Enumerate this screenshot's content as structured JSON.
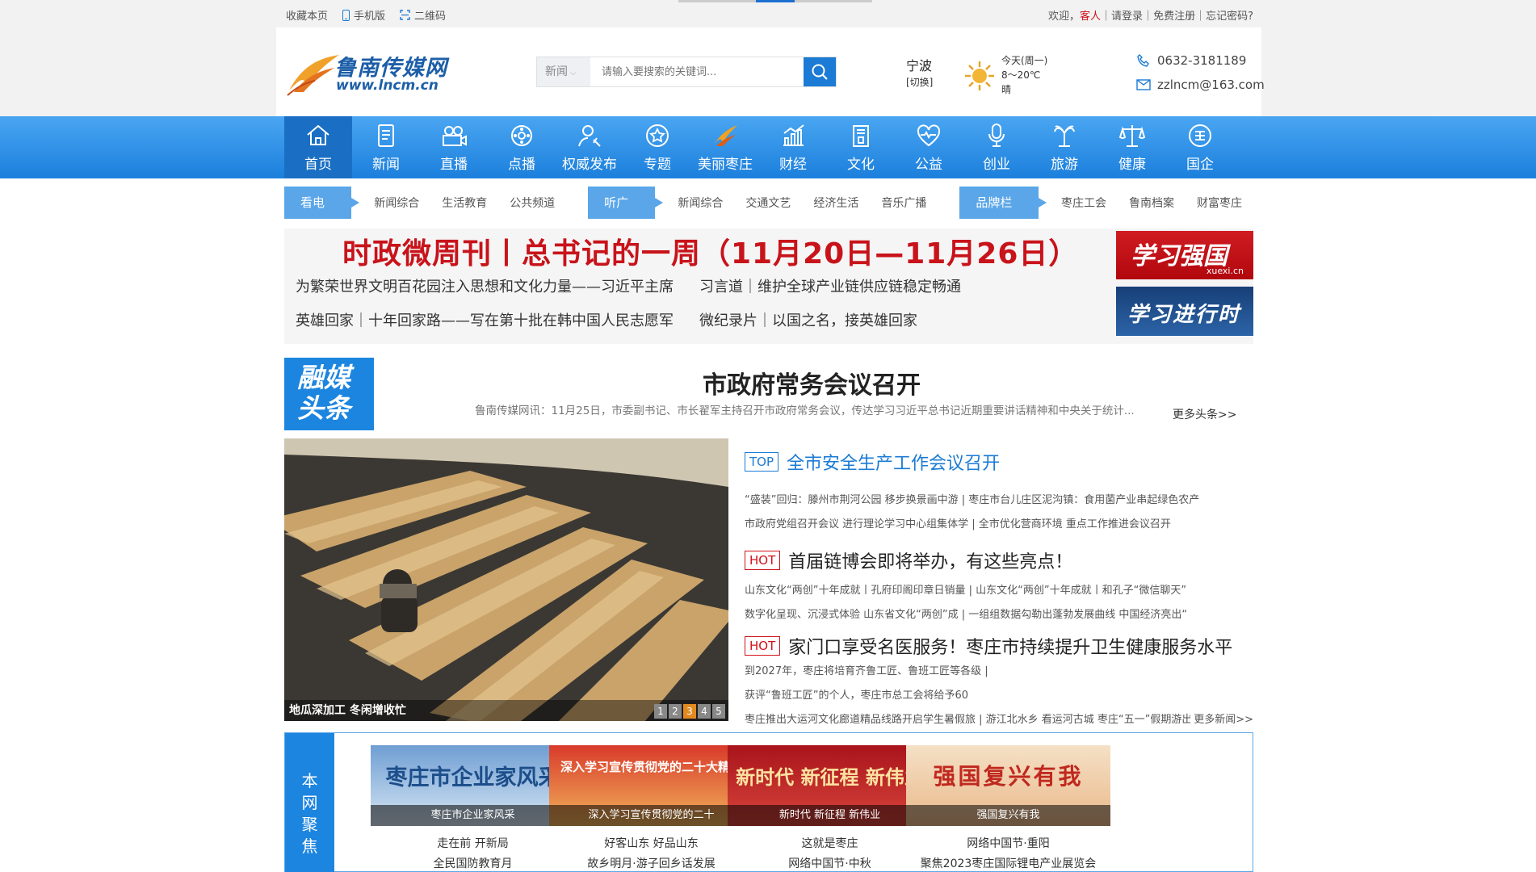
{
  "topbar": {
    "bookmark": "收藏本页",
    "mobile": "手机版",
    "qrcode": "二维码",
    "welcome": "欢迎，",
    "guest": "客人",
    "sep1": "｜",
    "login": "请登录",
    "sep2": "｜",
    "register": "免费注册",
    "sep3": "｜",
    "forgot": "忘记密码?"
  },
  "header": {
    "logo_cn": "鲁南传媒网",
    "logo_url": "www.lncm.cn",
    "search_category": "新闻",
    "search_placeholder": "请输入要搜索的关键词...",
    "city": "宁波",
    "city_switch": "[切换]",
    "weather_day": "今天(周一)",
    "weather_temp": "8～20℃",
    "weather_desc": "晴",
    "phone": "0632-3181189",
    "email": "zzlncm@163.com"
  },
  "nav": {
    "items": [
      {
        "label": "首页",
        "icon": "home-icon"
      },
      {
        "label": "新闻",
        "icon": "news-icon"
      },
      {
        "label": "直播",
        "icon": "live-icon"
      },
      {
        "label": "点播",
        "icon": "vod-icon"
      },
      {
        "label": "权威发布",
        "icon": "release-icon"
      },
      {
        "label": "专题",
        "icon": "topic-icon"
      },
      {
        "label": "美丽枣庄",
        "icon": "scenery-icon"
      },
      {
        "label": "财经",
        "icon": "finance-icon"
      },
      {
        "label": "文化",
        "icon": "culture-icon"
      },
      {
        "label": "公益",
        "icon": "charity-icon"
      },
      {
        "label": "创业",
        "icon": "startup-icon"
      },
      {
        "label": "旅游",
        "icon": "travel-icon"
      },
      {
        "label": "健康",
        "icon": "health-icon"
      },
      {
        "label": "国企",
        "icon": "soe-icon"
      }
    ]
  },
  "subnav": {
    "tv": "看电视",
    "tv_links": [
      "新闻综合",
      "生活教育",
      "公共频道"
    ],
    "radio": "听广播",
    "radio_links": [
      "新闻综合",
      "交通文艺",
      "经济生活",
      "音乐广播"
    ],
    "brand": "品牌栏目",
    "brand_links": [
      "枣庄工会",
      "鲁南档案",
      "财富枣庄"
    ]
  },
  "topnews": {
    "headline": "时政微周刊丨总书记的一周（11月20日—11月26日）",
    "links": [
      "为繁荣世界文明百花园注入思想和文化力量——习近平主席",
      "习言道｜维护全球产业链供应链稳定畅通",
      "英雄回家｜十年回家路——写在第十批在韩中国人民志愿军",
      "微纪录片｜以国之名，接英雄回家"
    ],
    "xxqg": "学习强国",
    "xxqg_url": "xuexi.cn",
    "xxjxs": "学习进行时"
  },
  "rongmei": {
    "badge": "融媒头条",
    "headline": "市政府常务会议召开",
    "summary": "鲁南传媒网讯：11月25日，市委副书记、市长翟军主持召开市政府常务会议，传达学习习近平总书记近期重要讲话精神和中央关于统计...",
    "more": "更多头条>>"
  },
  "slide": {
    "caption": "地瓜深加工 冬闲增收忙",
    "pages": [
      "1",
      "2",
      "3",
      "4",
      "5"
    ],
    "active": "3"
  },
  "news": [
    {
      "badge": "TOP",
      "title": "全市安全生产工作会议召开",
      "lines": [
        "“盛装”回归：滕州市荆河公园 移步换景画中游 | 枣庄市台儿庄区泥沟镇：食用菌产业串起绿色农产",
        "市政府党组召开会议 进行理论学习中心组集体学 | 全市优化营商环境 重点工作推进会议召开"
      ]
    },
    {
      "badge": "HOT",
      "title": "首届链博会即将举办，有这些亮点！",
      "lines": [
        "山东文化“两创”十年成就丨孔府印阁印章日销量 | 山东文化“两创”十年成就丨和孔子“微信聊天”",
        "数字化呈现、沉浸式体验 山东省文化“两创”成 | 一组组数据勾勒出蓬勃发展曲线 中国经济亮出“"
      ]
    },
    {
      "badge": "HOT",
      "title": "家门口享受名医服务！枣庄市持续提升卫生健康服务水平",
      "lines": [
        "到2027年，枣庄将培育齐鲁工匠、鲁班工匠等各级 |",
        "获评“鲁班工匠”的个人，枣庄市总工会将给予60",
        "枣庄推出大运河文化廊道精品线路开启学生暑假旅 | 游江北水乡 看运河古城 枣庄“五一”假期游出“"
      ],
      "more": "更多新闻>>"
    }
  ],
  "focus": {
    "label": "本网聚焦",
    "cards": [
      {
        "big": "枣庄市企业家风采",
        "caption": "枣庄市企业家风采",
        "links": [
          "走在前 开新局",
          "全民国防教育月"
        ]
      },
      {
        "big": "深入学习宣传贯彻党的二十大精神",
        "caption": "深入学习宣传贯彻党的二十",
        "links": [
          "好客山东 好品山东",
          "故乡明月·游子回乡话发展"
        ]
      },
      {
        "big": "新时代 新征程 新伟业",
        "caption": "新时代 新征程 新伟业",
        "links": [
          "这就是枣庄",
          "网络中国节·中秋"
        ]
      },
      {
        "big": "强国复兴有我",
        "caption": "强国复兴有我",
        "links": [
          "网络中国节·重阳",
          "聚焦2023枣庄国际锂电产业展览会"
        ]
      }
    ]
  },
  "colors": {
    "brand": "#1b7bd5",
    "red": "#c8131a",
    "nav_top": "#4aa6f2",
    "nav_bottom": "#1b7fdc"
  }
}
